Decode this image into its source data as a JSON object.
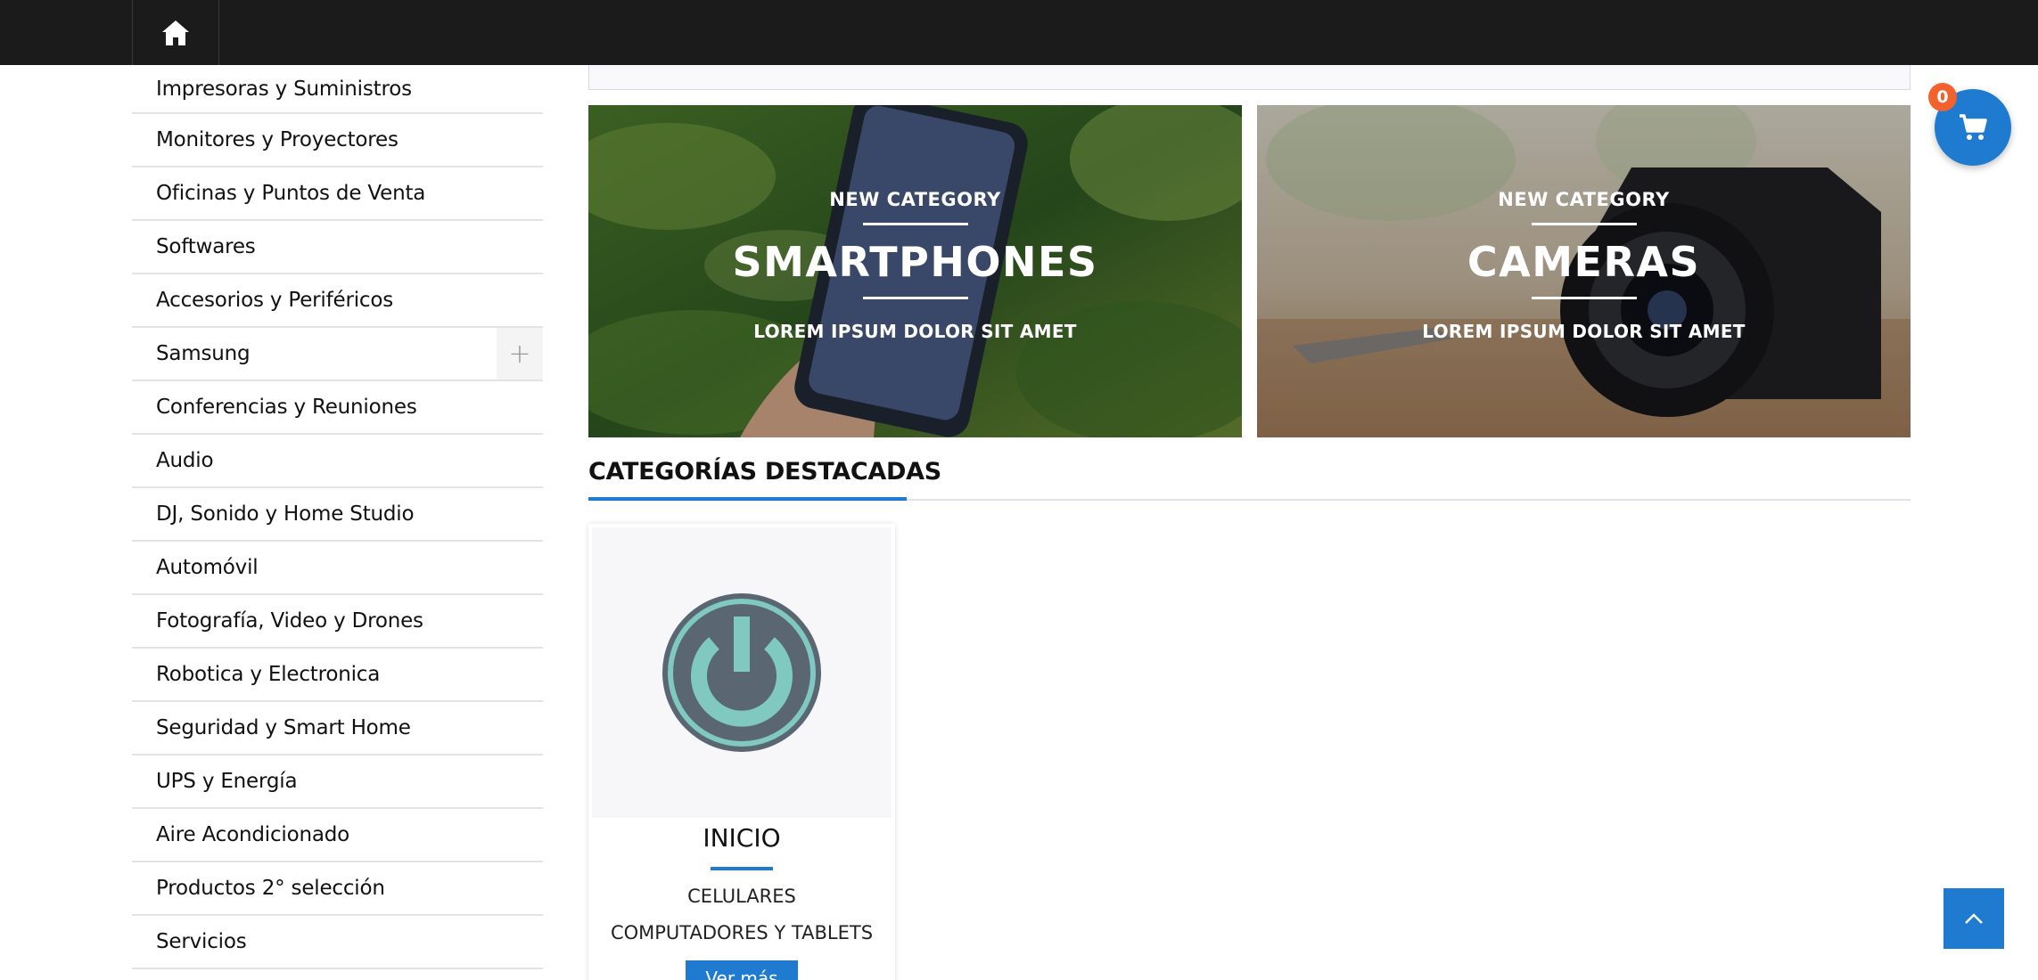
{
  "header": {
    "home_icon": "home-icon"
  },
  "sidebar": {
    "items": [
      {
        "label": "Impresoras y Suministros"
      },
      {
        "label": "Monitores y Proyectores"
      },
      {
        "label": "Oficinas y Puntos de Venta"
      },
      {
        "label": "Softwares"
      },
      {
        "label": "Accesorios y Periféricos"
      },
      {
        "label": "Samsung",
        "expand_symbol": "+"
      },
      {
        "label": "Conferencias y Reuniones"
      },
      {
        "label": "Audio"
      },
      {
        "label": "DJ, Sonido y Home Studio"
      },
      {
        "label": "Automóvil"
      },
      {
        "label": "Fotografía, Video y Drones"
      },
      {
        "label": "Robotica y Electronica"
      },
      {
        "label": "Seguridad y Smart Home"
      },
      {
        "label": "UPS y Energía"
      },
      {
        "label": "Aire Acondicionado"
      },
      {
        "label": "Productos 2° selección"
      },
      {
        "label": "Servicios"
      }
    ]
  },
  "banners": [
    {
      "kicker": "NEW CATEGORY",
      "title": "SMARTPHONES",
      "subtitle": "LOREM IPSUM DOLOR SIT AMET"
    },
    {
      "kicker": "NEW CATEGORY",
      "title": "CAMERAS",
      "subtitle": "LOREM IPSUM DOLOR SIT AMET"
    }
  ],
  "featured": {
    "title": "CATEGORÍAS DESTACADAS",
    "cards": [
      {
        "title": "INICIO",
        "icon": "power-icon",
        "subcategories": [
          "CELULARES",
          "COMPUTADORES Y TABLETS"
        ],
        "button_label": "Ver más"
      }
    ]
  },
  "cart": {
    "count": "0",
    "icon": "cart-icon"
  },
  "back_to_top": {
    "icon": "chevron-up-icon"
  },
  "colors": {
    "topbar": "#1b1b1b",
    "accent": "#1f7bd0",
    "badge": "#f3622d"
  }
}
